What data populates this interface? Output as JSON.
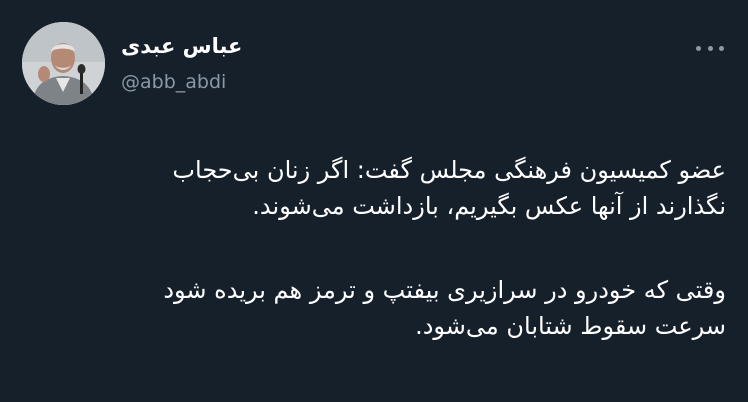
{
  "author": {
    "display_name": "عباس عبدی",
    "handle": "@abb_abdi"
  },
  "menu": {
    "icon": "more-horizontal-icon"
  },
  "tweet": {
    "paragraphs": [
      {
        "lines": [
          "عضو کمیسیون فرهنگی مجلس گفت: اگر زنان بی‌حجاب",
          "نگذارند از آنها عکس بگیریم، بازداشت می‌شوند."
        ]
      },
      {
        "lines": [
          "وقتی که خودرو در سرازیری بیفتپ و ترمز هم بریده شود",
          "سرعت سقوط شتابان می‌شود."
        ]
      }
    ]
  },
  "colors": {
    "background": "#15202b",
    "text": "#ffffff",
    "secondary_text": "#8b98a5"
  }
}
